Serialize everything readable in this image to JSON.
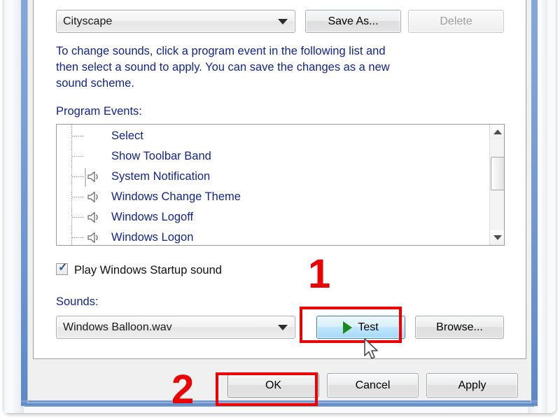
{
  "window": {
    "title": "Sound",
    "frame_accent_color": "#5d88c6",
    "body_color": "#f0f0f0"
  },
  "scheme": {
    "combo_value": "Cityscape",
    "save_as_label": "Save As...",
    "delete_label": "Delete",
    "delete_disabled": true
  },
  "description": {
    "line1": "To change sounds, click a program event in the following list and",
    "line2": "then select a sound to apply.  You can save the changes as a new",
    "line3": "sound scheme."
  },
  "program_events": {
    "label": "Program Events:",
    "items": [
      {
        "label": "Select",
        "has_sound_icon": false,
        "selected": false
      },
      {
        "label": "Show Toolbar Band",
        "has_sound_icon": false,
        "selected": false
      },
      {
        "label": "System Notification",
        "has_sound_icon": true,
        "selected": true
      },
      {
        "label": "Windows Change Theme",
        "has_sound_icon": true,
        "selected": false
      },
      {
        "label": "Windows Logoff",
        "has_sound_icon": true,
        "selected": false
      },
      {
        "label": "Windows Logon",
        "has_sound_icon": true,
        "selected": false
      }
    ],
    "scrollbar": {
      "up_arrow": "scroll-up-arrow",
      "down_arrow": "scroll-down-arrow",
      "thumb_position_percent": 30
    }
  },
  "startup_sound": {
    "label": "Play Windows Startup sound",
    "checked": true,
    "check_glyph": "✓",
    "check_color": "#2a5699"
  },
  "sounds": {
    "label": "Sounds:",
    "combo_value": "Windows Balloon.wav",
    "test_label": "Test",
    "test_icon": "play-triangle-icon",
    "test_icon_color": "#1a8a18",
    "test_hovered": true,
    "browse_label": "Browse..."
  },
  "footer": {
    "ok_label": "OK",
    "cancel_label": "Cancel",
    "apply_label": "Apply"
  },
  "annotations": {
    "color": "#ec0000",
    "step_one": "1",
    "step_two": "2"
  }
}
